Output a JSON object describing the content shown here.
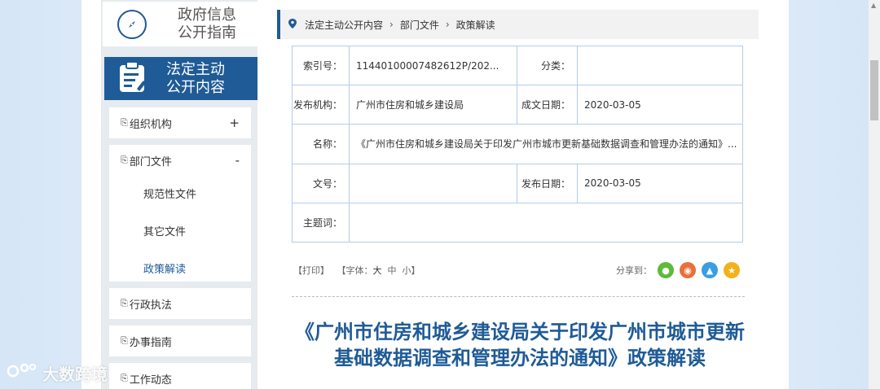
{
  "sidebar": {
    "guide_label": "政府信息\n公开指南",
    "active_label": "法定主动\n公开内容",
    "items": [
      {
        "label": "组织机构",
        "toggle": "+"
      },
      {
        "label": "部门文件",
        "toggle": "-"
      },
      {
        "label": "行政执法",
        "toggle": ""
      },
      {
        "label": "办事指南",
        "toggle": ""
      },
      {
        "label": "工作动态",
        "toggle": ""
      }
    ],
    "sub_items": [
      "规范性文件",
      "其它文件",
      "政策解读"
    ]
  },
  "breadcrumb": {
    "items": [
      "法定主动公开内容",
      "部门文件",
      "政策解读"
    ]
  },
  "info": {
    "index_label": "索引号：",
    "index_value": "11440100007482612P/202...",
    "category_label": "分类：",
    "category_value": "",
    "publisher_label": "发布机构：",
    "publisher_value": "广州市住房和城乡建设局",
    "written_date_label": "成文日期：",
    "written_date_value": "2020-03-05",
    "name_label": "名称：",
    "name_value": "《广州市住房和城乡建设局关于印发广州市城市更新基础数据调查和管理办法的通知》...",
    "doc_no_label": "文号：",
    "doc_no_value": "",
    "publish_date_label": "发布日期：",
    "publish_date_value": "2020-03-05",
    "subject_label": "主题词：",
    "subject_value": ""
  },
  "tools": {
    "print": "【打印】",
    "font_prefix": "【字体：",
    "font_large": "大",
    "font_medium": "中",
    "font_small": "小",
    "font_suffix": "】",
    "share_label": "分享到："
  },
  "article": {
    "title": "《广州市住房和城乡建设局关于印发广州市城市更新基础数据调查和管理办法的通知》政策解读"
  },
  "watermark": {
    "text": "大数跨境"
  },
  "colors": {
    "accent": "#1f5b96",
    "table_border": "#b3cde8",
    "wechat": "#5dba3b",
    "weibo": "#e8703a",
    "qq": "#3a9ee0",
    "qzone": "#f1b21a"
  }
}
